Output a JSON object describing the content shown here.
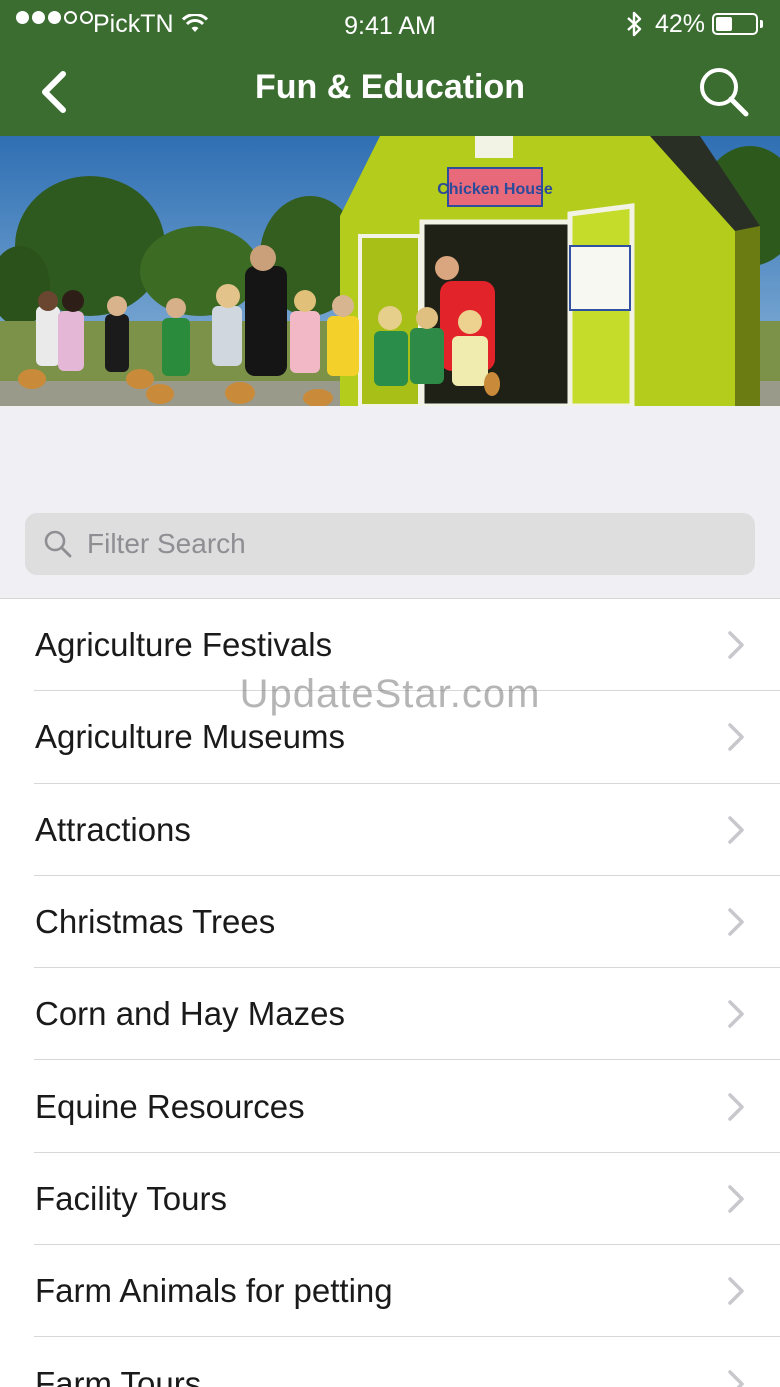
{
  "status_bar": {
    "carrier": "PickTN",
    "time": "9:41 AM",
    "battery_percent": "42%",
    "battery_level": 0.42,
    "signal_bars_filled": 3,
    "signal_bars_total": 5
  },
  "nav": {
    "title": "Fun & Education",
    "back_icon": "chevron-left-icon",
    "search_icon": "search-icon"
  },
  "hero": {
    "description_icon": "hero-photo",
    "sign_text": "Chicken House"
  },
  "filter": {
    "placeholder": "Filter Search",
    "value": ""
  },
  "categories": [
    {
      "label": "Agriculture Festivals"
    },
    {
      "label": "Agriculture Museums"
    },
    {
      "label": "Attractions"
    },
    {
      "label": "Christmas Trees"
    },
    {
      "label": "Corn and Hay Mazes"
    },
    {
      "label": "Equine Resources"
    },
    {
      "label": "Facility Tours"
    },
    {
      "label": "Farm Animals for petting"
    },
    {
      "label": "Farm Tours"
    }
  ],
  "watermark": "UpdateStar.com",
  "colors": {
    "header_green": "#3b6d31",
    "barn_green": "#b4cd1c",
    "list_bg": "#ffffff",
    "chevron": "#c7c7cc"
  }
}
